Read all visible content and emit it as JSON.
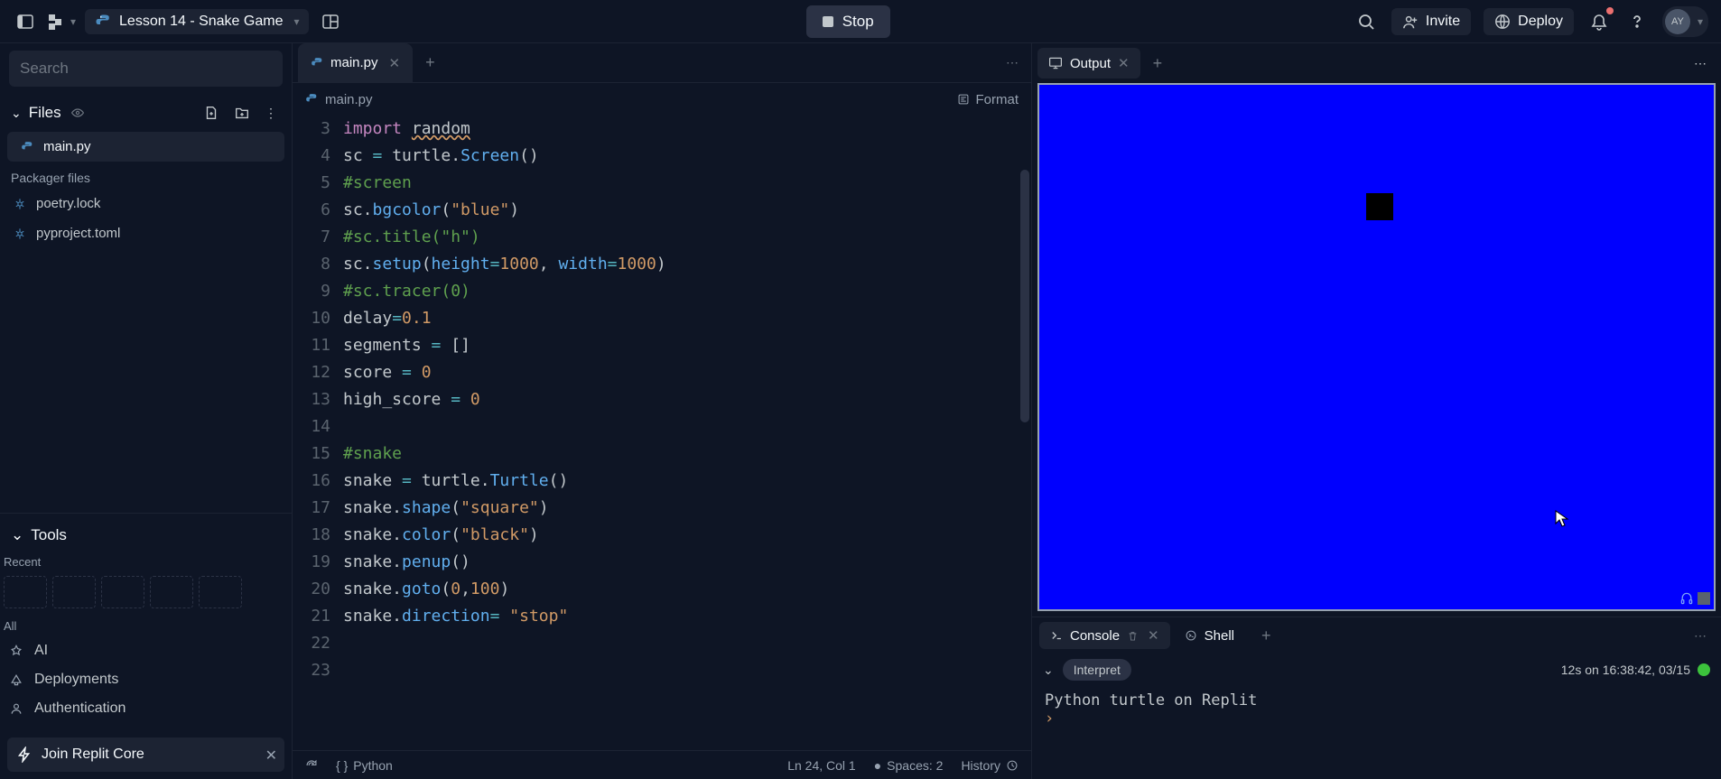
{
  "topbar": {
    "project_name": "Lesson 14 - Snake Game",
    "stop_label": "Stop",
    "invite_label": "Invite",
    "deploy_label": "Deploy",
    "avatar_initials": "AY"
  },
  "sidebar": {
    "search_placeholder": "Search",
    "files_label": "Files",
    "active_file": "main.py",
    "packager_label": "Packager files",
    "pkg_files": [
      "poetry.lock",
      "pyproject.toml"
    ],
    "tools_label": "Tools",
    "recent_label": "Recent",
    "all_label": "All",
    "tools": [
      "AI",
      "Deployments",
      "Authentication"
    ],
    "join_label": "Join Replit Core"
  },
  "editor": {
    "tab_name": "main.py",
    "breadcrumb_file": "main.py",
    "format_label": "Format",
    "line_start": 3,
    "lines": [
      {
        "n": 3,
        "html": "<span class='kw'>import</span> <span class='wavy'>random</span>"
      },
      {
        "n": 4,
        "html": "sc <span class='op'>=</span> turtle.<span class='fn'>Screen</span>()"
      },
      {
        "n": 5,
        "html": "<span class='cm'>#screen</span>"
      },
      {
        "n": 6,
        "html": "sc.<span class='fn'>bgcolor</span>(<span class='str'>\"blue\"</span>)"
      },
      {
        "n": 7,
        "html": "<span class='cm'>#sc.title(\"h\")</span>"
      },
      {
        "n": 8,
        "html": "sc.<span class='fn'>setup</span>(<span class='fn'>height</span><span class='op'>=</span><span class='num'>1000</span>, <span class='fn'>width</span><span class='op'>=</span><span class='num'>1000</span>)"
      },
      {
        "n": 9,
        "html": "<span class='cm'>#sc.tracer(0)</span>"
      },
      {
        "n": 10,
        "html": "delay<span class='op'>=</span><span class='num'>0.1</span>"
      },
      {
        "n": 11,
        "html": "segments <span class='op'>=</span> []"
      },
      {
        "n": 12,
        "html": "score <span class='op'>=</span> <span class='num'>0</span>"
      },
      {
        "n": 13,
        "html": "high_score <span class='op'>=</span> <span class='num'>0</span>"
      },
      {
        "n": 14,
        "html": ""
      },
      {
        "n": 15,
        "html": "<span class='cm'>#snake</span>"
      },
      {
        "n": 16,
        "html": "snake <span class='op'>=</span> turtle.<span class='fn'>Turtle</span>()"
      },
      {
        "n": 17,
        "html": "snake.<span class='fn'>shape</span>(<span class='str'>\"square\"</span>)"
      },
      {
        "n": 18,
        "html": "snake.<span class='fn'>color</span>(<span class='str'>\"black\"</span>)"
      },
      {
        "n": 19,
        "html": "snake.<span class='fn'>penup</span>()"
      },
      {
        "n": 20,
        "html": "snake.<span class='fn'>goto</span>(<span class='num'>0</span>,<span class='num'>100</span>)"
      },
      {
        "n": 21,
        "html": "snake.<span class='fn'>direction</span><span class='op'>=</span> <span class='str'>\"stop\"</span>"
      },
      {
        "n": 22,
        "html": ""
      },
      {
        "n": 23,
        "html": ""
      }
    ],
    "status": {
      "lang": "Python",
      "cursor": "Ln 24, Col 1",
      "spaces": "Spaces: 2",
      "history": "History"
    }
  },
  "output": {
    "tab_label": "Output",
    "canvas_bg": "#0000fe"
  },
  "console": {
    "console_tab": "Console",
    "shell_tab": "Shell",
    "interpret_label": "Interpret",
    "run_status": "12s on 16:38:42, 03/15",
    "output_line": "Python turtle on Replit",
    "prompt": "› "
  }
}
